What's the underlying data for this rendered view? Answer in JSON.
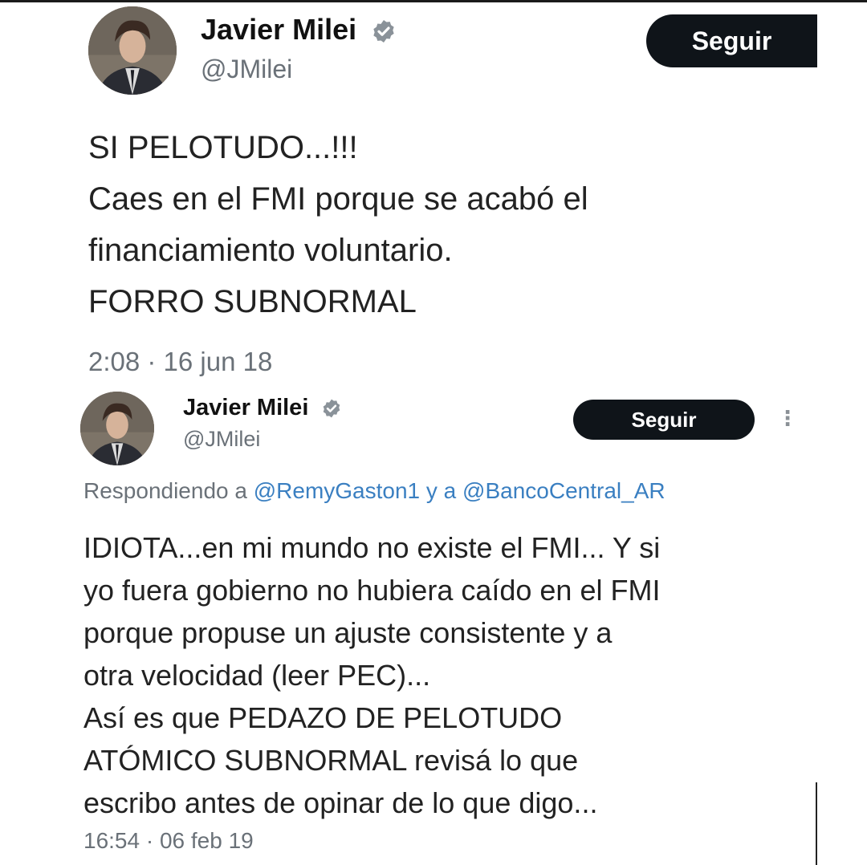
{
  "tweets": [
    {
      "author": {
        "name": "Javier Milei",
        "handle": "@JMilei",
        "verified_icon": "verified-badge-icon"
      },
      "follow_label": "Seguir",
      "text": "SI PELOTUDO...!!!\nCaes en el FMI porque se acabó el\nfinanciamiento voluntario.\nFORRO SUBNORMAL",
      "timestamp": "2:08 · 16 jun 18"
    },
    {
      "author": {
        "name": "Javier Milei",
        "handle": "@JMilei",
        "verified_icon": "verified-badge-icon"
      },
      "follow_label": "Seguir",
      "more_icon": "more-options-icon",
      "reply_prefix": "Respondiendo a",
      "reply_mentions": [
        "@RemyGaston1",
        "@BancoCentral_AR"
      ],
      "reply_joiner": "y a",
      "text": "IDIOTA...en mi mundo no existe el FMI... Y si\nyo fuera gobierno no hubiera caído en el FMI\nporque propuse un ajuste consistente y a\notra velocidad (leer PEC)...\nAsí es que PEDAZO DE PELOTUDO\nATÓMICO SUBNORMAL revisá lo que\nescribo antes de opinar de lo que digo...",
      "timestamp": "16:54 · 06 feb 19"
    }
  ],
  "colors": {
    "text": "#0f1419",
    "muted": "#6a7178",
    "mention": "#3a7fc1",
    "button": "#0f1419",
    "verified": "#8a9299"
  }
}
